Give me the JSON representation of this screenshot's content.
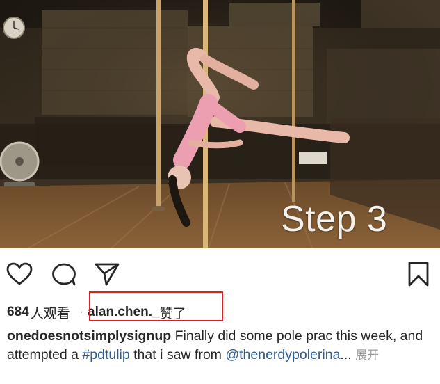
{
  "media": {
    "overlay_text": "Step 3"
  },
  "actions": {
    "like_icon": "heart-icon",
    "comment_icon": "comment-bubble-icon",
    "share_icon": "paper-plane-icon",
    "save_icon": "bookmark-icon"
  },
  "stats": {
    "views_count": "684",
    "views_suffix": "人观看",
    "separator": "·",
    "liker_username": "alan.chen._",
    "liker_action": "赞了",
    "highlight_color": "#e02020"
  },
  "caption": {
    "username": "onedoesnotsimplysignup",
    "text_part1": " Finally did some pole prac this week, and  attempted a ",
    "hashtag": "#pdtulip",
    "text_part2": " that i saw from ",
    "mention": "@thenerdypolerina",
    "ellipsis": "...",
    "more_label": " 展开",
    "link_color": "#2f5a8f"
  }
}
